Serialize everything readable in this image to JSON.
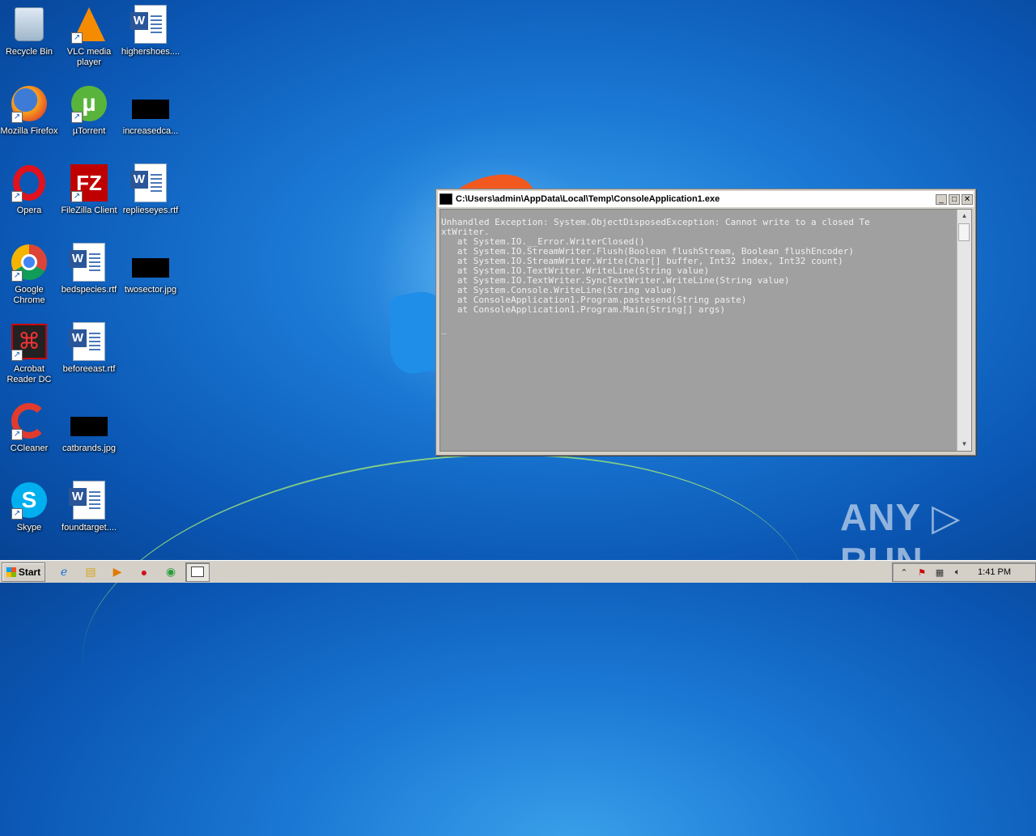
{
  "desktop": {
    "icons": [
      {
        "label": "Recycle Bin",
        "icon": "recycle-bin-icon"
      },
      {
        "label": "VLC media player",
        "icon": "vlc-icon"
      },
      {
        "label": "highershoes....",
        "icon": "word-document-icon"
      },
      {
        "label": "Mozilla Firefox",
        "icon": "firefox-icon"
      },
      {
        "label": "µTorrent",
        "icon": "utorrent-icon"
      },
      {
        "label": "increasedca...",
        "icon": "image-thumbnail-icon"
      },
      {
        "label": "Opera",
        "icon": "opera-icon"
      },
      {
        "label": "FileZilla Client",
        "icon": "filezilla-icon"
      },
      {
        "label": "replieseyes.rtf",
        "icon": "word-document-icon"
      },
      {
        "label": "Google Chrome",
        "icon": "chrome-icon"
      },
      {
        "label": "bedspecies.rtf",
        "icon": "word-document-icon"
      },
      {
        "label": "twosector.jpg",
        "icon": "image-thumbnail-icon"
      },
      {
        "label": "Acrobat Reader DC",
        "icon": "acrobat-icon"
      },
      {
        "label": "beforeeast.rtf",
        "icon": "word-document-icon"
      },
      {
        "label": "CCleaner",
        "icon": "ccleaner-icon"
      },
      {
        "label": "catbrands.jpg",
        "icon": "image-thumbnail-icon"
      },
      {
        "label": "Skype",
        "icon": "skype-icon"
      },
      {
        "label": "foundtarget....",
        "icon": "word-document-icon"
      }
    ]
  },
  "console_window": {
    "title": "C:\\Users\\admin\\AppData\\Local\\Temp\\ConsoleApplication1.exe",
    "output": "Unhandled Exception: System.ObjectDisposedException: Cannot write to a closed Te\nxtWriter.\n   at System.IO.__Error.WriterClosed()\n   at System.IO.StreamWriter.Flush(Boolean flushStream, Boolean flushEncoder)\n   at System.IO.StreamWriter.Write(Char[] buffer, Int32 index, Int32 count)\n   at System.IO.TextWriter.WriteLine(String value)\n   at System.IO.TextWriter.SyncTextWriter.WriteLine(String value)\n   at System.Console.WriteLine(String value)\n   at ConsoleApplication1.Program.pastesend(String paste)\n   at ConsoleApplication1.Program.Main(String[] args)\n\n_",
    "minimize_label": "_",
    "maximize_label": "□",
    "close_label": "✕"
  },
  "watermark": {
    "text": "ANY ▷ RUN"
  },
  "taskbar": {
    "start_label": "Start",
    "quick_launch": [
      "ie-icon",
      "explorer-icon",
      "media-player-icon",
      "opera-icon",
      "chrome-icon"
    ],
    "clock": "1:41 PM"
  }
}
